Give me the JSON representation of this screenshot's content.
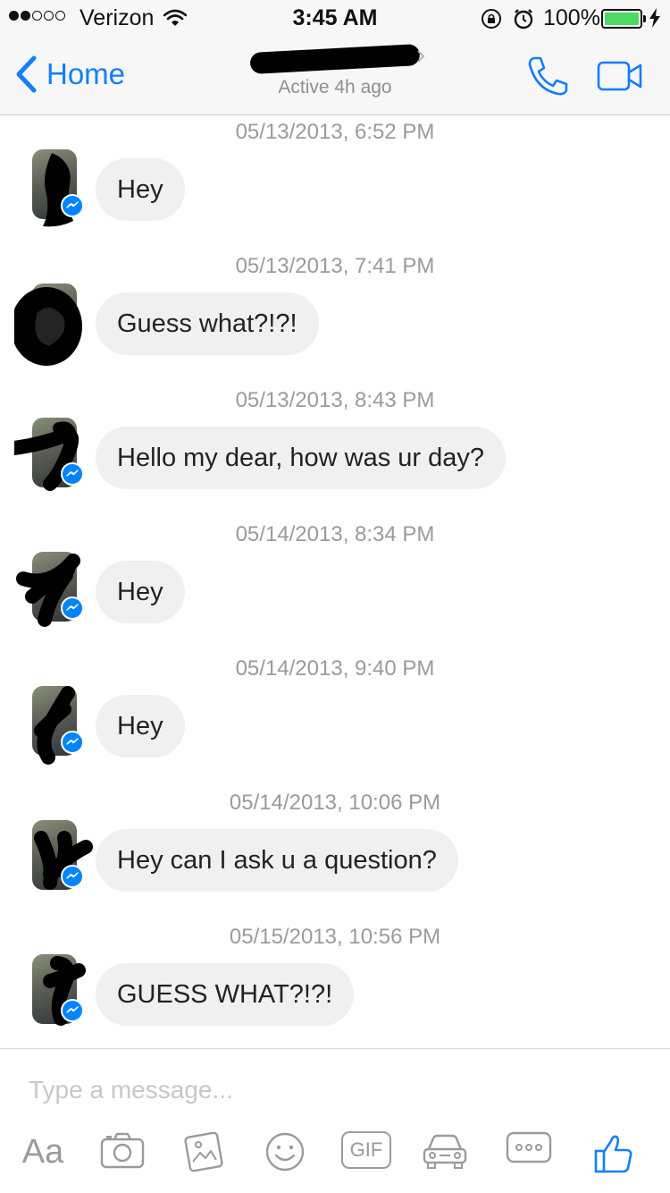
{
  "status_bar": {
    "carrier": "Verizon",
    "time": "3:45 AM",
    "battery_percent": "100%",
    "signal_bars_filled": 2,
    "signal_bars_total": 5
  },
  "header": {
    "back_label": "Home",
    "status": "Active 4h ago"
  },
  "messages": [
    {
      "timestamp": "05/13/2013, 6:52 PM",
      "text": "Hey"
    },
    {
      "timestamp": "05/13/2013, 7:41 PM",
      "text": "Guess what?!?!"
    },
    {
      "timestamp": "05/13/2013, 8:43 PM",
      "text": "Hello my dear, how was ur day?"
    },
    {
      "timestamp": "05/14/2013, 8:34 PM",
      "text": "Hey"
    },
    {
      "timestamp": "05/14/2013, 9:40 PM",
      "text": "Hey"
    },
    {
      "timestamp": "05/14/2013, 10:06 PM",
      "text": "Hey can I ask u a question?"
    },
    {
      "timestamp": "05/15/2013, 10:56 PM",
      "text": "GUESS WHAT?!?!"
    }
  ],
  "composer": {
    "placeholder": "Type a message...",
    "text_format_label": "Aa",
    "gif_label": "GIF"
  },
  "icons": [
    "wifi-icon",
    "rotation-lock-icon",
    "alarm-icon",
    "battery-icon",
    "charging-icon",
    "back-chevron-icon",
    "chevron-right-icon",
    "phone-icon",
    "video-icon",
    "messenger-badge-icon",
    "camera-icon",
    "photo-icon",
    "emoji-icon",
    "gif-icon",
    "car-icon",
    "more-icon",
    "like-icon"
  ],
  "colors": {
    "accent": "#147efb",
    "messenger_blue": "#0084ff",
    "bubble_gray": "#f1f0f0",
    "battery_green": "#4cd964"
  }
}
